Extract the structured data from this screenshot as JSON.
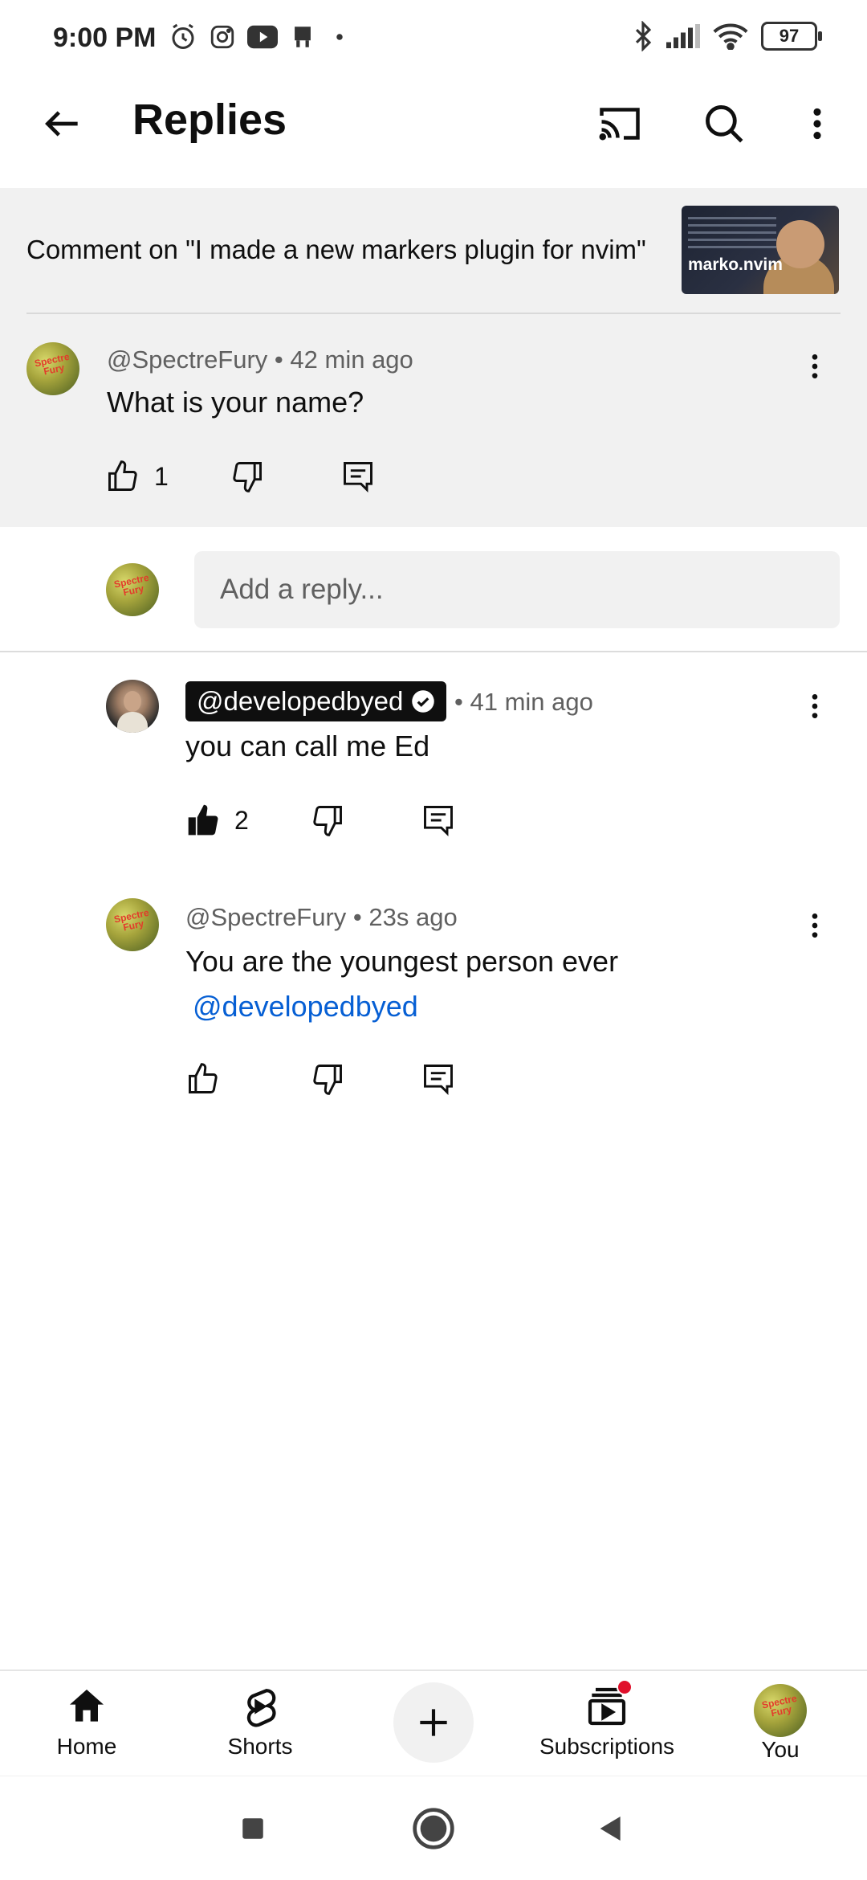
{
  "status_bar": {
    "time": "9:00 PM",
    "battery": "97",
    "left_icons": [
      "alarm-icon",
      "instagram-icon",
      "youtube-icon",
      "notification-icon"
    ],
    "right_icons": [
      "bluetooth-icon",
      "signal-icon",
      "wifi-icon",
      "battery-icon"
    ]
  },
  "app_bar": {
    "title": "Replies",
    "icons": [
      "back-arrow-icon",
      "cast-icon",
      "search-icon",
      "more-vert-icon"
    ]
  },
  "video_context": {
    "text": "Comment on \"I made a new markers plugin for nvim\"",
    "thumbnail_label": "marko.nvim"
  },
  "parent_comment": {
    "author": "@SpectreFury",
    "time": "42 min ago",
    "text": "What is your name?",
    "likes": "1"
  },
  "reply_box": {
    "placeholder": "Add a reply..."
  },
  "replies": [
    {
      "author": "@developedbyed",
      "verified": true,
      "time": "41 min ago",
      "text": "you can call me Ed",
      "likes": "2",
      "liked": true
    },
    {
      "author": "@SpectreFury",
      "time": "23s ago",
      "text": "You are the youngest person ever",
      "mention": "@developedbyed",
      "likes": ""
    }
  ],
  "avatar_text": {
    "line1": "Spectre",
    "line2": "Fury"
  },
  "bottom_nav": {
    "home": "Home",
    "shorts": "Shorts",
    "subscriptions": "Subscriptions",
    "you": "You"
  },
  "colors": {
    "accent_link": "#065fd4",
    "notification_dot": "#e0102b",
    "section_bg": "#f1f1f1"
  }
}
